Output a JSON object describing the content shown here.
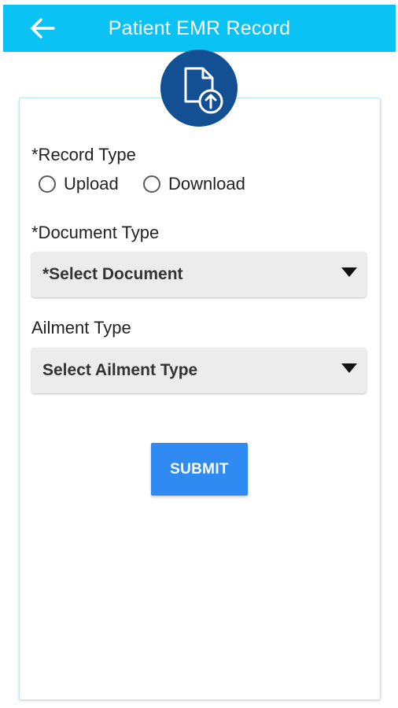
{
  "app_bar": {
    "title": "Patient EMR Record",
    "back_icon": "arrow-left-icon",
    "background_color": "#0ac2f4"
  },
  "header_badge": {
    "icon": "document-upload-icon",
    "background_color": "#134f93"
  },
  "form": {
    "record_type": {
      "label": "*Record Type",
      "options": [
        {
          "label": "Upload",
          "selected": false
        },
        {
          "label": "Download",
          "selected": false
        }
      ]
    },
    "document_type": {
      "label": "*Document Type",
      "selected_value": "*Select Document"
    },
    "ailment_type": {
      "label": "Ailment Type",
      "selected_value": "Select Ailment Type"
    },
    "submit_label": "SUBMIT",
    "submit_color": "#2f8bf2"
  }
}
